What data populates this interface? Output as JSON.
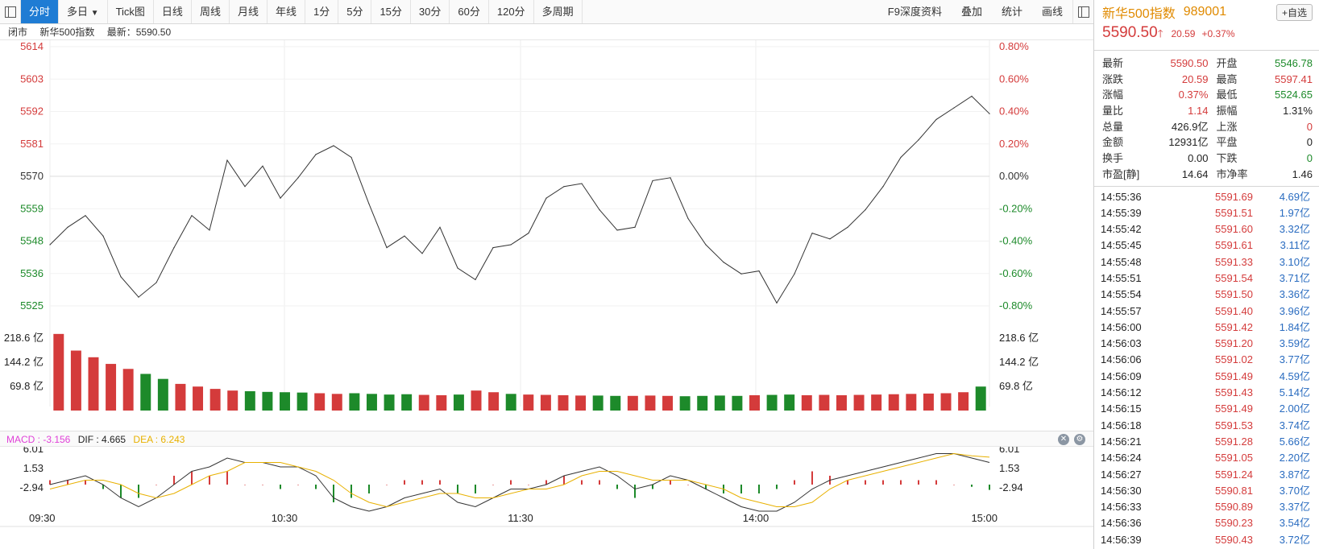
{
  "toolbar": {
    "tabs": [
      "分时",
      "多日",
      "Tick图",
      "日线",
      "周线",
      "月线",
      "年线",
      "1分",
      "5分",
      "15分",
      "30分",
      "60分",
      "120分",
      "多周期"
    ],
    "dropdown_arrow": "▼",
    "right": [
      "F9深度资料",
      "叠加",
      "统计",
      "画线"
    ]
  },
  "infobar": {
    "status": "闭市",
    "name": "新华500指数",
    "latest_label": "最新：5590.50"
  },
  "price_axis": {
    "left": [
      "5614",
      "5603",
      "5592",
      "5581",
      "5570",
      "5559",
      "5548",
      "5536",
      "5525"
    ],
    "right": [
      "0.80%",
      "0.60%",
      "0.40%",
      "0.20%",
      "0.00%",
      "-0.20%",
      "-0.40%",
      "-0.60%",
      "-0.80%"
    ]
  },
  "volume_axis": [
    "218.6 亿",
    "144.2 亿",
    "69.8 亿"
  ],
  "macd_axis": [
    "6.01",
    "1.53",
    "-2.94"
  ],
  "time_axis": [
    "09:30",
    "10:30",
    "11:30",
    "14:00",
    "15:00"
  ],
  "macd_bar": {
    "macd": "MACD : -3.156",
    "dif": "DIF : 4.665",
    "dea": "DEA : 6.243"
  },
  "colors": {
    "accent": "#1f7cd4",
    "up": "#d43b3b",
    "down": "#1d8a2a",
    "price_line": "#333333",
    "dea_line": "#e8b100",
    "macd_label": "#e040d8"
  },
  "header": {
    "title": "新华500指数",
    "code": "989001",
    "add_label": "+自选"
  },
  "quote": {
    "price": "5590.50",
    "arrow": "🡑",
    "change": "20.59",
    "pct": "+0.37%"
  },
  "stats": [
    {
      "k1": "最新",
      "v1": "5590.50",
      "c1": "red",
      "k2": "开盘",
      "v2": "5546.78",
      "c2": "green"
    },
    {
      "k1": "涨跌",
      "v1": "20.59",
      "c1": "red",
      "k2": "最高",
      "v2": "5597.41",
      "c2": "red"
    },
    {
      "k1": "涨幅",
      "v1": "0.37%",
      "c1": "red",
      "k2": "最低",
      "v2": "5524.65",
      "c2": "green"
    },
    {
      "k1": "量比",
      "v1": "1.14",
      "c1": "red",
      "k2": "振幅",
      "v2": "1.31%",
      "c2": "blk"
    },
    {
      "k1": "总量",
      "v1": "426.9亿",
      "c1": "blk",
      "k2": "上涨",
      "v2": "0",
      "c2": "red"
    },
    {
      "k1": "金额",
      "v1": "12931亿",
      "c1": "blk",
      "k2": "平盘",
      "v2": "0",
      "c2": "blk"
    },
    {
      "k1": "换手",
      "v1": "0.00",
      "c1": "blk",
      "k2": "下跌",
      "v2": "0",
      "c2": "green"
    },
    {
      "k1": "市盈[静]",
      "v1": "14.64",
      "c1": "blk",
      "k2": "市净率",
      "v2": "1.46",
      "c2": "blk"
    }
  ],
  "ticks": [
    {
      "time": "14:55:36",
      "price": "5591.69",
      "vol": "4.69亿"
    },
    {
      "time": "14:55:39",
      "price": "5591.51",
      "vol": "1.97亿"
    },
    {
      "time": "14:55:42",
      "price": "5591.60",
      "vol": "3.32亿"
    },
    {
      "time": "14:55:45",
      "price": "5591.61",
      "vol": "3.11亿"
    },
    {
      "time": "14:55:48",
      "price": "5591.33",
      "vol": "3.10亿"
    },
    {
      "time": "14:55:51",
      "price": "5591.54",
      "vol": "3.71亿"
    },
    {
      "time": "14:55:54",
      "price": "5591.50",
      "vol": "3.36亿"
    },
    {
      "time": "14:55:57",
      "price": "5591.40",
      "vol": "3.96亿"
    },
    {
      "time": "14:56:00",
      "price": "5591.42",
      "vol": "1.84亿"
    },
    {
      "time": "14:56:03",
      "price": "5591.20",
      "vol": "3.59亿"
    },
    {
      "time": "14:56:06",
      "price": "5591.02",
      "vol": "3.77亿"
    },
    {
      "time": "14:56:09",
      "price": "5591.49",
      "vol": "4.59亿"
    },
    {
      "time": "14:56:12",
      "price": "5591.43",
      "vol": "5.14亿"
    },
    {
      "time": "14:56:15",
      "price": "5591.49",
      "vol": "2.00亿"
    },
    {
      "time": "14:56:18",
      "price": "5591.53",
      "vol": "3.74亿"
    },
    {
      "time": "14:56:21",
      "price": "5591.28",
      "vol": "5.66亿"
    },
    {
      "time": "14:56:24",
      "price": "5591.05",
      "vol": "2.20亿"
    },
    {
      "time": "14:56:27",
      "price": "5591.24",
      "vol": "3.87亿"
    },
    {
      "time": "14:56:30",
      "price": "5590.81",
      "vol": "3.70亿"
    },
    {
      "time": "14:56:33",
      "price": "5590.89",
      "vol": "3.37亿"
    },
    {
      "time": "14:56:36",
      "price": "5590.23",
      "vol": "3.54亿"
    },
    {
      "time": "14:56:39",
      "price": "5590.43",
      "vol": "3.72亿"
    }
  ],
  "chart_data": {
    "type": "line",
    "price": {
      "ylim": [
        5525,
        5614
      ],
      "baseline": 5570,
      "x": [
        "09:30",
        "09:35",
        "09:40",
        "09:45",
        "09:50",
        "09:55",
        "10:00",
        "10:05",
        "10:10",
        "10:15",
        "10:20",
        "10:25",
        "10:30",
        "10:35",
        "10:40",
        "10:45",
        "10:50",
        "10:55",
        "11:00",
        "11:05",
        "11:10",
        "11:15",
        "11:20",
        "11:25",
        "11:30",
        "11:35",
        "11:40",
        "11:45",
        "11:50",
        "11:55",
        "13:05",
        "13:10",
        "13:15",
        "13:20",
        "13:25",
        "13:30",
        "13:35",
        "13:40",
        "13:45",
        "13:50",
        "13:55",
        "14:00",
        "14:05",
        "14:10",
        "14:15",
        "14:20",
        "14:25",
        "14:30",
        "14:35",
        "14:40",
        "14:45",
        "14:50",
        "14:55",
        "15:00"
      ],
      "values": [
        5546,
        5552,
        5556,
        5549,
        5535,
        5528,
        5533,
        5545,
        5556,
        5551,
        5575,
        5566,
        5573,
        5562,
        5569,
        5577,
        5580,
        5576,
        5560,
        5545,
        5549,
        5543,
        5552,
        5538,
        5534,
        5545,
        5546,
        5550,
        5562,
        5566,
        5567,
        5558,
        5551,
        5552,
        5568,
        5569,
        5555,
        5546,
        5540,
        5536,
        5537,
        5526,
        5536,
        5550,
        5548,
        5552,
        5558,
        5566,
        5576,
        5582,
        5589,
        5593,
        5597,
        5591
      ],
      "note": ""
    },
    "volume": {
      "unit": "亿",
      "ylim": [
        0,
        290
      ],
      "x": [
        "09:30",
        "09:35",
        "09:40",
        "09:45",
        "09:50",
        "09:55",
        "10:00",
        "10:05",
        "10:10",
        "10:15",
        "10:20",
        "10:25",
        "10:30",
        "10:35",
        "10:40",
        "10:45",
        "10:50",
        "10:55",
        "11:00",
        "11:05",
        "11:10",
        "11:15",
        "11:20",
        "11:25",
        "11:30",
        "11:35",
        "11:40",
        "11:45",
        "11:50",
        "11:55",
        "13:05",
        "13:10",
        "13:15",
        "13:20",
        "13:25",
        "13:30",
        "13:35",
        "13:40",
        "13:45",
        "13:50",
        "13:55",
        "14:00",
        "14:05",
        "14:10",
        "14:15",
        "14:20",
        "14:25",
        "14:30",
        "14:35",
        "14:40",
        "14:45",
        "14:50",
        "14:55",
        "15:00"
      ],
      "values": [
        230,
        180,
        160,
        140,
        125,
        110,
        95,
        80,
        72,
        65,
        60,
        58,
        56,
        55,
        54,
        52,
        50,
        52,
        50,
        48,
        49,
        47,
        46,
        48,
        60,
        55,
        50,
        48,
        47,
        46,
        45,
        45,
        44,
        44,
        45,
        44,
        43,
        44,
        45,
        44,
        46,
        47,
        48,
        46,
        47,
        46,
        47,
        48,
        49,
        50,
        51,
        52,
        55,
        72
      ],
      "colors": [
        "up",
        "up",
        "up",
        "up",
        "up",
        "down",
        "down",
        "up",
        "up",
        "up",
        "up",
        "down",
        "down",
        "down",
        "down",
        "up",
        "up",
        "down",
        "down",
        "down",
        "down",
        "up",
        "up",
        "down",
        "up",
        "up",
        "down",
        "up",
        "up",
        "up",
        "up",
        "down",
        "down",
        "up",
        "up",
        "up",
        "down",
        "down",
        "down",
        "down",
        "up",
        "down",
        "down",
        "up",
        "up",
        "up",
        "up",
        "up",
        "up",
        "up",
        "up",
        "up",
        "up",
        "down"
      ]
    },
    "macd": {
      "ylim": [
        -6,
        8
      ],
      "x": [
        "09:30",
        "09:35",
        "09:40",
        "09:45",
        "09:50",
        "09:55",
        "10:00",
        "10:05",
        "10:10",
        "10:15",
        "10:20",
        "10:25",
        "10:30",
        "10:35",
        "10:40",
        "10:45",
        "10:50",
        "10:55",
        "11:00",
        "11:05",
        "11:10",
        "11:15",
        "11:20",
        "11:25",
        "11:30",
        "11:35",
        "11:40",
        "11:45",
        "11:50",
        "11:55",
        "13:05",
        "13:10",
        "13:15",
        "13:20",
        "13:25",
        "13:30",
        "13:35",
        "13:40",
        "13:45",
        "13:50",
        "13:55",
        "14:00",
        "14:05",
        "14:10",
        "14:15",
        "14:20",
        "14:25",
        "14:30",
        "14:35",
        "14:40",
        "14:45",
        "14:50",
        "14:55",
        "15:00"
      ],
      "dif": [
        0,
        1,
        2,
        0,
        -3,
        -5,
        -3,
        0,
        3,
        4,
        6,
        5,
        5,
        4,
        4,
        2,
        -3,
        -5,
        -6,
        -5,
        -3,
        -2,
        -1,
        -4,
        -5,
        -3,
        -1,
        -1,
        0,
        2,
        3,
        4,
        2,
        -1,
        0,
        2,
        1,
        -1,
        -3,
        -5,
        -6,
        -6,
        -4,
        -1,
        1,
        2,
        3,
        4,
        5,
        6,
        7,
        7,
        6,
        5
      ],
      "dea": [
        -1,
        0,
        1,
        1,
        0,
        -2,
        -3,
        -2,
        0,
        2,
        3,
        5,
        5,
        5,
        4,
        3,
        1,
        -2,
        -4,
        -5,
        -4,
        -3,
        -2,
        -2,
        -3,
        -3,
        -2,
        -1,
        -1,
        0,
        2,
        3,
        3,
        2,
        1,
        1,
        1,
        0,
        -1,
        -3,
        -4,
        -5,
        -5,
        -4,
        -1,
        1,
        2,
        3,
        4,
        5,
        6,
        7,
        6.5,
        6.2
      ],
      "hist": [
        1,
        1,
        1,
        -1,
        -3,
        -3,
        0,
        2,
        3,
        2,
        3,
        0,
        0,
        -1,
        0,
        -1,
        -4,
        -3,
        -2,
        0,
        1,
        1,
        1,
        -2,
        -2,
        0,
        1,
        0,
        1,
        2,
        1,
        1,
        -1,
        -3,
        -1,
        1,
        0,
        -1,
        -2,
        -2,
        -2,
        -1,
        1,
        3,
        2,
        1,
        1,
        1,
        1,
        1,
        1,
        0,
        -0.5,
        -1.2
      ]
    },
    "time_axis": [
      "09:30",
      "10:30",
      "11:30",
      "14:00",
      "15:00"
    ]
  }
}
